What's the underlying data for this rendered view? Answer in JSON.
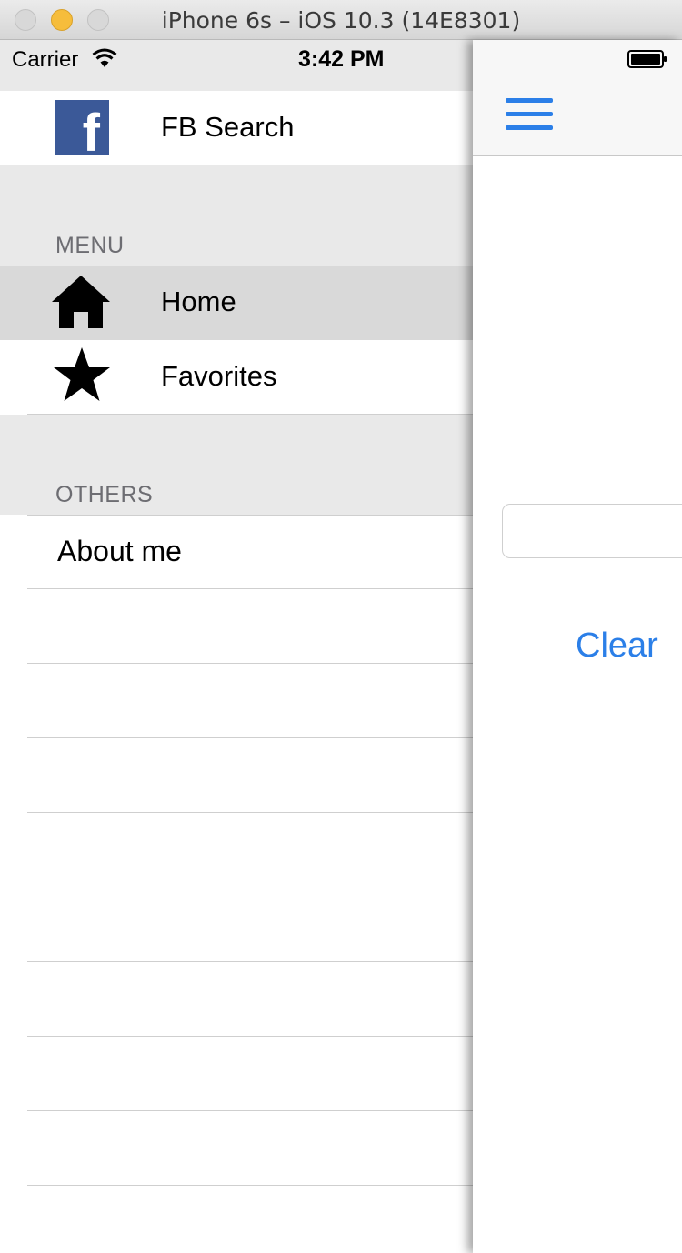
{
  "window": {
    "title": "iPhone 6s – iOS 10.3 (14E8301)"
  },
  "status_bar": {
    "carrier": "Carrier",
    "time": "3:42 PM"
  },
  "menu": {
    "header_item": {
      "label": "FB Search",
      "icon": "facebook-icon"
    },
    "sections": [
      {
        "title": "MENU",
        "items": [
          {
            "label": "Home",
            "icon": "home-icon",
            "selected": true
          },
          {
            "label": "Favorites",
            "icon": "star-icon",
            "selected": false
          }
        ]
      },
      {
        "title": "OTHERS",
        "items": [
          {
            "label": "About me"
          }
        ]
      }
    ]
  },
  "main": {
    "menu_button_icon": "hamburger-icon",
    "search_input": {
      "value": "",
      "placeholder": ""
    },
    "clear_label": "Clear"
  },
  "colors": {
    "accent": "#2b7fe8",
    "facebook": "#3b5998",
    "section_bg": "#e9e9e9",
    "selected_bg": "#d9d9d9"
  }
}
